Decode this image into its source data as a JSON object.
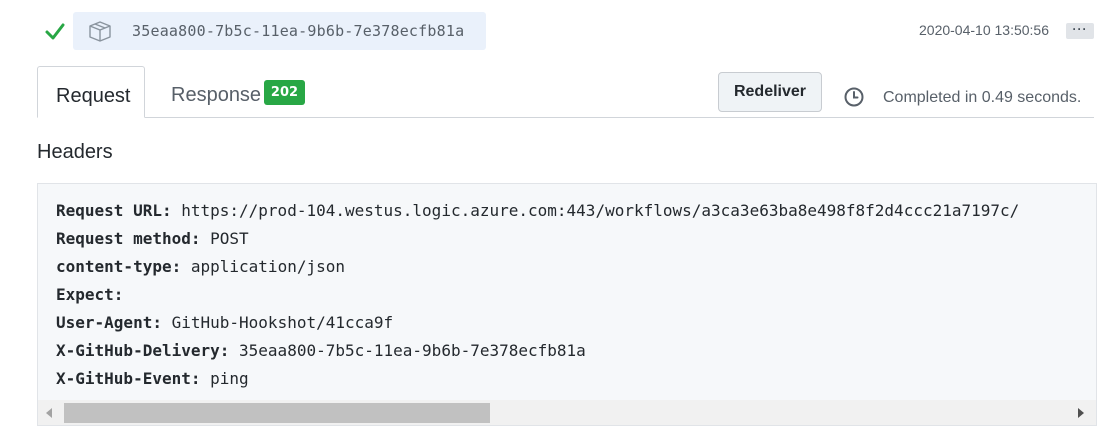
{
  "delivery": {
    "status_icon": "checkmark-icon",
    "package_icon": "package-icon",
    "guid": "35eaa800-7b5c-11ea-9b6b-7e378ecfb81a",
    "timestamp": "2020-04-10 13:50:56",
    "more_label": "···"
  },
  "tabs": {
    "request_label": "Request",
    "response_label": "Response",
    "response_badge": "202"
  },
  "actions": {
    "redeliver_label": "Redeliver",
    "clock_icon": "clock-icon",
    "completed_text": "Completed in 0.49 seconds."
  },
  "headers_section": {
    "title": "Headers",
    "lines": [
      {
        "key": "Request URL:",
        "value": " https://prod-104.westus.logic.azure.com:443/workflows/a3ca3e63ba8e498f8f2d4ccc21a7197c/"
      },
      {
        "key": "Request method:",
        "value": " POST"
      },
      {
        "key": "content-type:",
        "value": " application/json"
      },
      {
        "key": "Expect:",
        "value": ""
      },
      {
        "key": "User-Agent:",
        "value": " GitHub-Hookshot/41cca9f"
      },
      {
        "key": "X-GitHub-Delivery:",
        "value": " 35eaa800-7b5c-11ea-9b6b-7e378ecfb81a"
      },
      {
        "key": "X-GitHub-Event:",
        "value": " ping"
      }
    ]
  },
  "colors": {
    "success": "#28a745",
    "pill_bg": "#eaf1fb",
    "code_bg": "#f6f8fa"
  }
}
